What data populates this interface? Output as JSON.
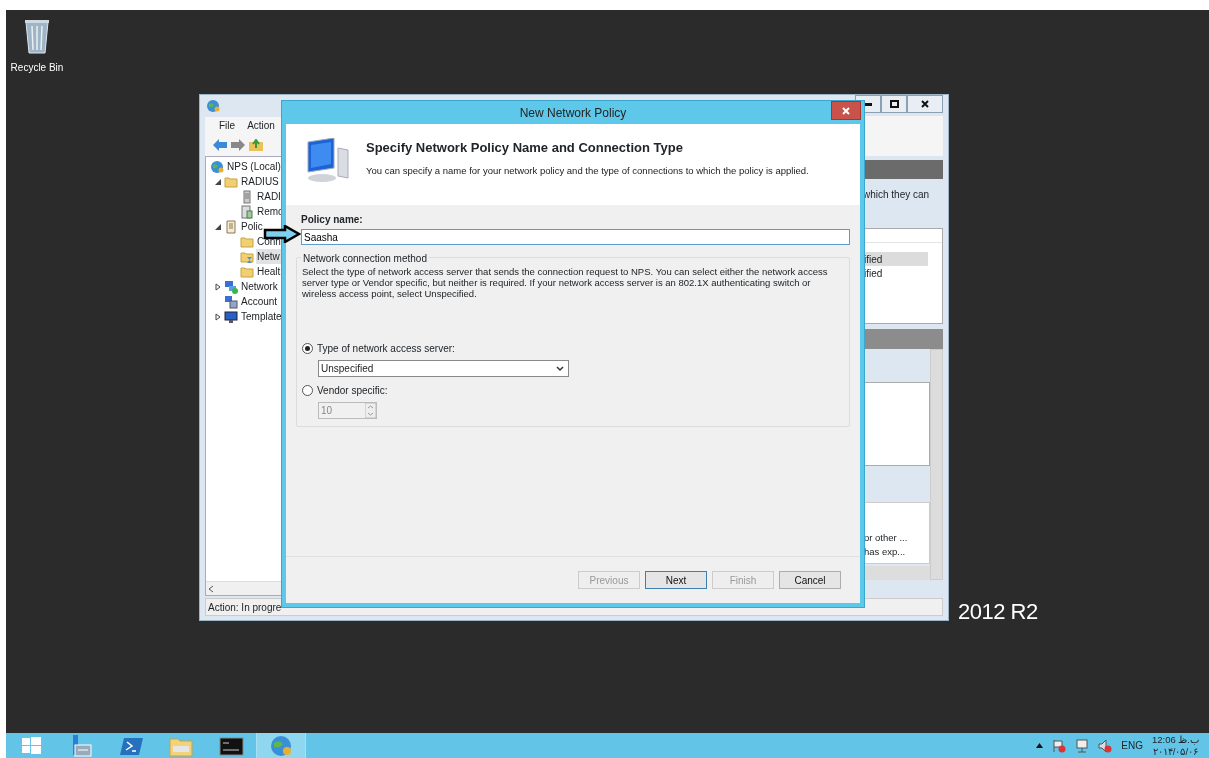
{
  "desktop": {
    "icons": [
      {
        "label": "Recycle Bin"
      }
    ],
    "wallpaper_text": "2012 R2"
  },
  "background_window": {
    "menu": [
      {
        "label": "File"
      },
      {
        "label": "Action"
      }
    ],
    "tree": [
      {
        "label": "NPS (Local)",
        "kind": "globe",
        "selected": false,
        "children": [
          {
            "label": "RADIUS",
            "kind": "folder",
            "selected": false,
            "expanded": true,
            "children": [
              {
                "label": "RADI",
                "kind": "server",
                "selected": false
              },
              {
                "label": "Remo",
                "kind": "server-group",
                "selected": false
              }
            ]
          },
          {
            "label": "Polic",
            "kind": "scroll",
            "selected": false,
            "expanded": true,
            "children": [
              {
                "label": "Conn",
                "kind": "folder",
                "selected": false
              },
              {
                "label": "Netw",
                "kind": "policy-folder",
                "selected": true
              },
              {
                "label": "Healt",
                "kind": "folder",
                "selected": false
              }
            ]
          },
          {
            "label": "Network",
            "kind": "network",
            "selected": false,
            "expanded": false
          },
          {
            "label": "Account",
            "kind": "computers",
            "selected": false
          },
          {
            "label": "Template",
            "kind": "monitor",
            "selected": false,
            "expanded": false
          }
        ]
      }
    ],
    "right_pane": {
      "description": "which they can",
      "list_rows": [
        {
          "cell": "ified",
          "selected": true
        },
        {
          "cell": "ified",
          "selected": false
        }
      ],
      "lower_rows": [
        {
          "cell": "or other ..."
        },
        {
          "cell": "has exp..."
        }
      ]
    },
    "status_bar": "Action:  In progre"
  },
  "dialog": {
    "title": "New Network Policy",
    "header_title": "Specify Network Policy Name and Connection Type",
    "header_description": "You can specify a name for your network policy and the type of connections to which the policy is applied.",
    "policy_name_label": "Policy name:",
    "policy_name_value": "Saasha",
    "group_title": "Network connection method",
    "group_description": "Select the type of network access server that sends the connection request to NPS. You can select either the network access server type or Vendor specific, but neither is required.  If your network access server is an 802.1X authenticating switch or wireless access point, select Unspecified.",
    "options": [
      {
        "label": "Type of network access server:",
        "selected": true,
        "kind": "select",
        "value": "Unspecified",
        "disabled": false
      },
      {
        "label": "Vendor specific:",
        "selected": false,
        "kind": "spinner",
        "value": "10",
        "disabled": true
      }
    ],
    "buttons": [
      {
        "label": "Previous",
        "disabled": true
      },
      {
        "label": "Next",
        "disabled": false
      },
      {
        "label": "Finish",
        "disabled": true
      },
      {
        "label": "Cancel",
        "disabled": false
      }
    ]
  },
  "taskbar": {
    "apps": [
      {
        "kind": "start",
        "selected": false
      },
      {
        "kind": "server-manager",
        "selected": false
      },
      {
        "kind": "powershell",
        "selected": false
      },
      {
        "kind": "explorer",
        "selected": false
      },
      {
        "kind": "cmd",
        "selected": false
      },
      {
        "kind": "nps",
        "selected": true
      }
    ],
    "language": "ENG",
    "time": "12:06 ب.ظ",
    "date": "۲۰۱۴/۰۵/۰۶"
  }
}
